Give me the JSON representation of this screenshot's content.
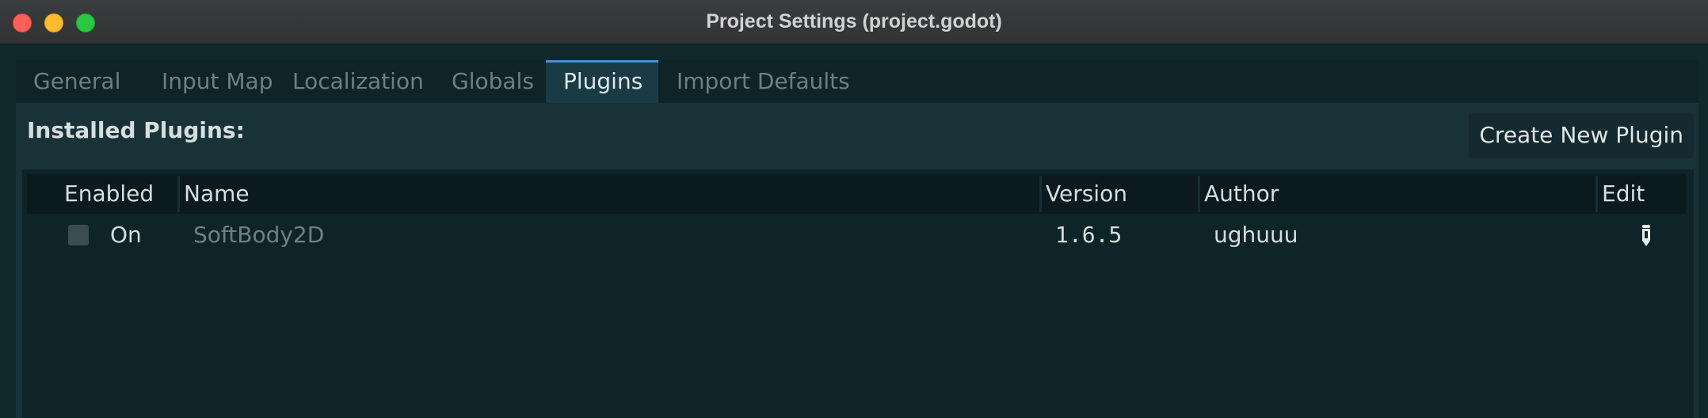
{
  "window": {
    "title": "Project Settings (project.godot)"
  },
  "tabs": [
    {
      "label": "General",
      "active": false
    },
    {
      "label": "Input Map",
      "active": false
    },
    {
      "label": "Localization",
      "active": false
    },
    {
      "label": "Globals",
      "active": false
    },
    {
      "label": "Plugins",
      "active": true
    },
    {
      "label": "Import Defaults",
      "active": false
    }
  ],
  "plugins_panel": {
    "title": "Installed Plugins:",
    "create_button_label": "Create New Plugin",
    "columns": {
      "enabled": "Enabled",
      "name": "Name",
      "version": "Version",
      "author": "Author",
      "edit": "Edit"
    },
    "rows": [
      {
        "enabled_checked": false,
        "enabled_label": "On",
        "name": "SoftBody2D",
        "version": "1.6.5",
        "author": "ughuuu",
        "edit_icon": "pencil-icon"
      }
    ]
  },
  "colors": {
    "accent": "#4a90c9",
    "background": "#183238",
    "text": "#d6dee0",
    "muted_text": "#6c8186"
  }
}
